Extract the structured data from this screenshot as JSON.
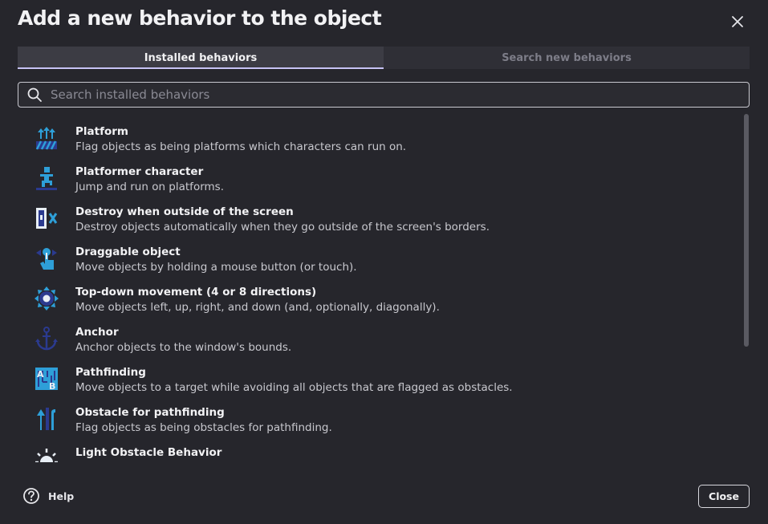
{
  "dialog": {
    "title": "Add a new behavior to the object",
    "close_icon": "close-icon"
  },
  "tabs": [
    {
      "label": "Installed behaviors",
      "active": true
    },
    {
      "label": "Search new behaviors",
      "active": false
    }
  ],
  "search": {
    "placeholder": "Search installed behaviors",
    "value": "",
    "icon": "search-icon"
  },
  "behaviors": [
    {
      "name": "Platform",
      "description": "Flag objects as being platforms which characters can run on.",
      "icon": "platform-icon"
    },
    {
      "name": "Platformer character",
      "description": "Jump and run on platforms.",
      "icon": "platformer-character-icon"
    },
    {
      "name": "Destroy when outside of the screen",
      "description": "Destroy objects automatically when they go outside of the screen's borders.",
      "icon": "destroy-outside-icon"
    },
    {
      "name": "Draggable object",
      "description": "Move objects by holding a mouse button (or touch).",
      "icon": "draggable-icon"
    },
    {
      "name": "Top-down movement (4 or 8 directions)",
      "description": "Move objects left, up, right, and down (and, optionally, diagonally).",
      "icon": "topdown-movement-icon"
    },
    {
      "name": "Anchor",
      "description": "Anchor objects to the window's bounds.",
      "icon": "anchor-icon"
    },
    {
      "name": "Pathfinding",
      "description": "Move objects to a target while avoiding all objects that are flagged as obstacles.",
      "icon": "pathfinding-icon"
    },
    {
      "name": "Obstacle for pathfinding",
      "description": "Flag objects as being obstacles for pathfinding.",
      "icon": "pathfinding-obstacle-icon"
    },
    {
      "name": "Light Obstacle Behavior",
      "description": "",
      "icon": "light-obstacle-icon"
    }
  ],
  "footer": {
    "help_label": "Help",
    "close_label": "Close"
  },
  "colors": {
    "background": "#26262c",
    "icon_blue": "#2e9fd8",
    "icon_dark_blue": "#2b3a8f",
    "active_tab_underline": "#c7c3f5"
  }
}
